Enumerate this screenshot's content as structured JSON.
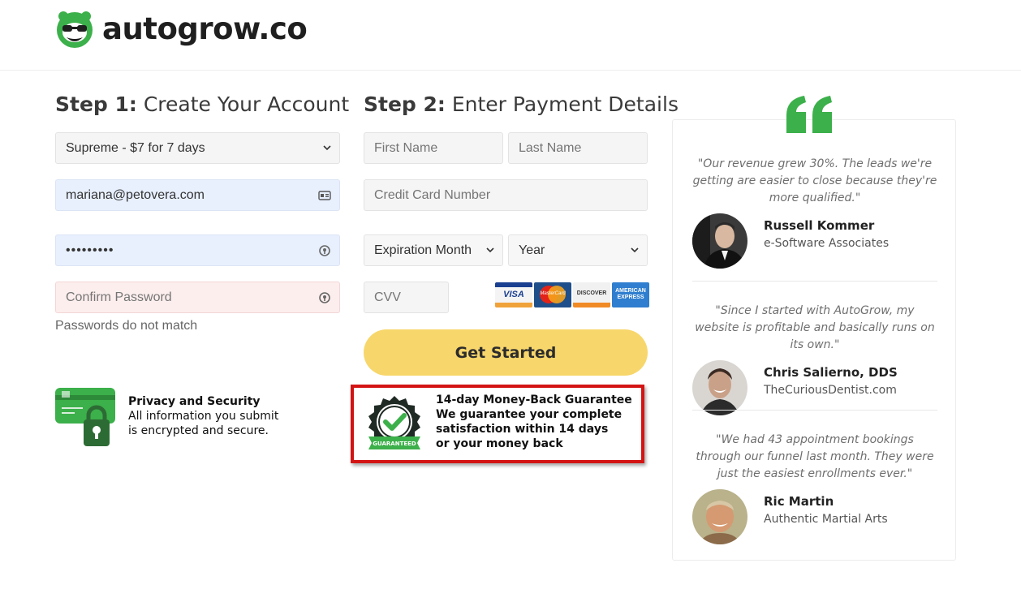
{
  "header": {
    "logo_text": "autogrow.co",
    "brand_color": "#3cb04a"
  },
  "step1": {
    "title_bold": "Step 1:",
    "title_rest": " Create Your Account",
    "plan": {
      "selected": "Supreme - $7 for 7 days"
    },
    "email": {
      "value": "mariana@petovera.com"
    },
    "password": {
      "value": "•••••••••"
    },
    "confirm_password": {
      "placeholder": "Confirm Password"
    },
    "error_text": "Passwords do not match"
  },
  "step2": {
    "title_bold": "Step 2:",
    "title_rest": " Enter Payment Details",
    "first_name": {
      "placeholder": "First Name"
    },
    "last_name": {
      "placeholder": "Last Name"
    },
    "card_number": {
      "placeholder": "Credit Card Number"
    },
    "exp_month": {
      "selected": "Expiration Month"
    },
    "exp_year": {
      "selected": "Year"
    },
    "cvv": {
      "placeholder": "CVV"
    },
    "cards": {
      "visa": "VISA",
      "mastercard": "MasterCard",
      "discover": "DISCOVER",
      "amex_line1": "AMERICAN",
      "amex_line2": "EXPRESS"
    },
    "submit_label": "Get Started",
    "submit_color": "#f7d66b"
  },
  "privacy": {
    "title": "Privacy and Security",
    "line1": "All information you submit",
    "line2": "is encrypted and secure."
  },
  "guarantee": {
    "title": "14-day Money-Back Guarantee",
    "line1": "We guarantee your complete",
    "line2": "satisfaction within 14 days",
    "line3": "or your money back",
    "seal_label": "GUARANTEED",
    "border_color": "#d41414"
  },
  "testimonials": [
    {
      "quote": "\"Our revenue grew 30%. The leads we're getting are easier to close because they're more qualified.\"",
      "name": "Russell Kommer",
      "company": "e-Software Associates"
    },
    {
      "quote": "\"Since I started with AutoGrow, my website is profitable and basically runs on its own.\"",
      "name": "Chris Salierno, DDS",
      "company": "TheCuriousDentist.com"
    },
    {
      "quote": "\"We had 43 appointment bookings through our funnel last month. They were just the easiest enrollments ever.\"",
      "name": "Ric Martin",
      "company": "Authentic Martial Arts"
    }
  ]
}
